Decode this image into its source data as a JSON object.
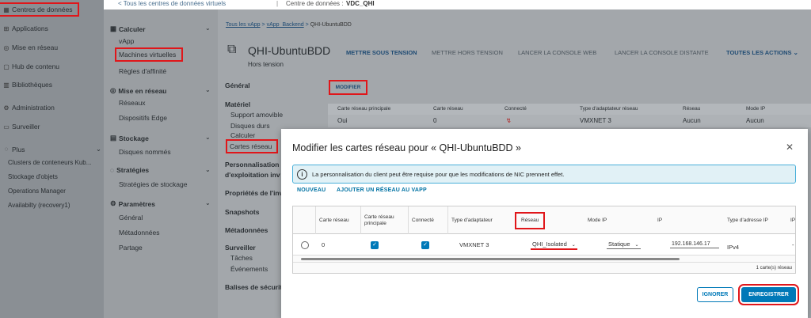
{
  "leftnav": {
    "items": [
      {
        "icon": "datacenter-icon",
        "glyph": "▦",
        "label": "Centres de données"
      },
      {
        "icon": "applications-icon",
        "glyph": "⊞",
        "label": "Applications"
      },
      {
        "icon": "network-icon",
        "glyph": "◎",
        "label": "Mise en réseau"
      },
      {
        "icon": "content-hub-icon",
        "glyph": "▢",
        "label": "Hub de contenu"
      },
      {
        "icon": "libraries-icon",
        "glyph": "▥",
        "label": "Bibliothèques"
      },
      {
        "icon": "administration-icon",
        "glyph": "⚙",
        "label": "Administration"
      },
      {
        "icon": "monitor-icon",
        "glyph": "▭",
        "label": "Surveiller"
      },
      {
        "icon": "plus-icon",
        "glyph": "◌",
        "label": "Plus"
      }
    ],
    "more_items": [
      "Clusters de conteneurs Kub...",
      "Stockage d'objets",
      "Operations Manager",
      "Availabilty (recovery1)"
    ]
  },
  "topbar": {
    "back_link": "< Tous les centres de données virtuels",
    "separator": "|",
    "datacenter": "Centre de données :",
    "datacenter_name": "VDC_QHI"
  },
  "midnav": {
    "calc_title": "Calculer",
    "calc_items": [
      "vApp",
      "Machines virtuelles",
      "Règles d'affinité"
    ],
    "net_title": "Mise en réseau",
    "net_items": [
      "Réseaux",
      "Dispositifs Edge"
    ],
    "storage_title": "Stockage",
    "storage_items": [
      "Disques nommés"
    ],
    "strategy_title": "Stratégies",
    "strategy_items": [
      "Stratégies de stockage"
    ],
    "params_title": "Paramètres",
    "params_items": [
      "Général",
      "Métadonnées",
      "Partage"
    ]
  },
  "content": {
    "breadcrumb": [
      "Tous les vApp",
      ">",
      "vApp_Backend",
      ">",
      "QHI-UbuntuBDD"
    ],
    "vm_name": "QHI-UbuntuBDD",
    "vm_status": "Hors tension",
    "actions": [
      "METTRE SOUS TENSION",
      "METTRE HORS TENSION",
      "LANCER LA CONSOLE WEB",
      "LANCER LA CONSOLE DISTANTE",
      "TOUTES LES ACTIONS"
    ],
    "vm_nav": {
      "general": "Général",
      "hardware": "Matériel",
      "hardware_items": [
        "Support amovible",
        "Disques durs",
        "Calculer",
        "Cartes réseau"
      ],
      "custom1": "Personnalisation",
      "custom2": "d'exploitation inv",
      "props": "Propriétés de l'inv",
      "snapshots": "Snapshots",
      "metadata": "Métadonnées",
      "monitor": "Surveiller",
      "monitor_items": [
        "Tâches",
        "Événements"
      ],
      "security": "Balises de sécurit"
    },
    "modify_button": "MODIFIER",
    "bg_table": {
      "headers": [
        "Carte réseau principale",
        "Carte réseau",
        "Connecté",
        "Type d'adaptateur réseau",
        "Réseau",
        "Mode IP"
      ],
      "row": [
        "Oui",
        "0",
        "",
        "VMXNET 3",
        "Aucun",
        "Aucun"
      ]
    }
  },
  "modal": {
    "title": "Modifier les cartes réseau pour « QHI-UbuntuBDD »",
    "close": "✕",
    "info_icon": "i",
    "info_text": "La personnalisation du client peut être requise pour que les modifications de NIC prennent effet.",
    "links": [
      "NOUVEAU",
      "AJOUTER UN RÉSEAU AU VAPP"
    ],
    "headers": [
      "Carte réseau",
      "Carte réseau principale",
      "Connecté",
      "Type d'adaptateur",
      "Réseau",
      "Mode IP",
      "IP",
      "Type d'adresse IP",
      "IP"
    ],
    "row": {
      "card": "0",
      "type": "VMXNET 3",
      "network": "QHI_Isolated",
      "ip_mode": "Statique",
      "ip": "192.168.146.17",
      "ip_type": "IPv4",
      "dash": "-"
    },
    "footer": "1 carte(s) réseau",
    "ignore": "IGNORER",
    "save": "ENREGISTRER"
  }
}
